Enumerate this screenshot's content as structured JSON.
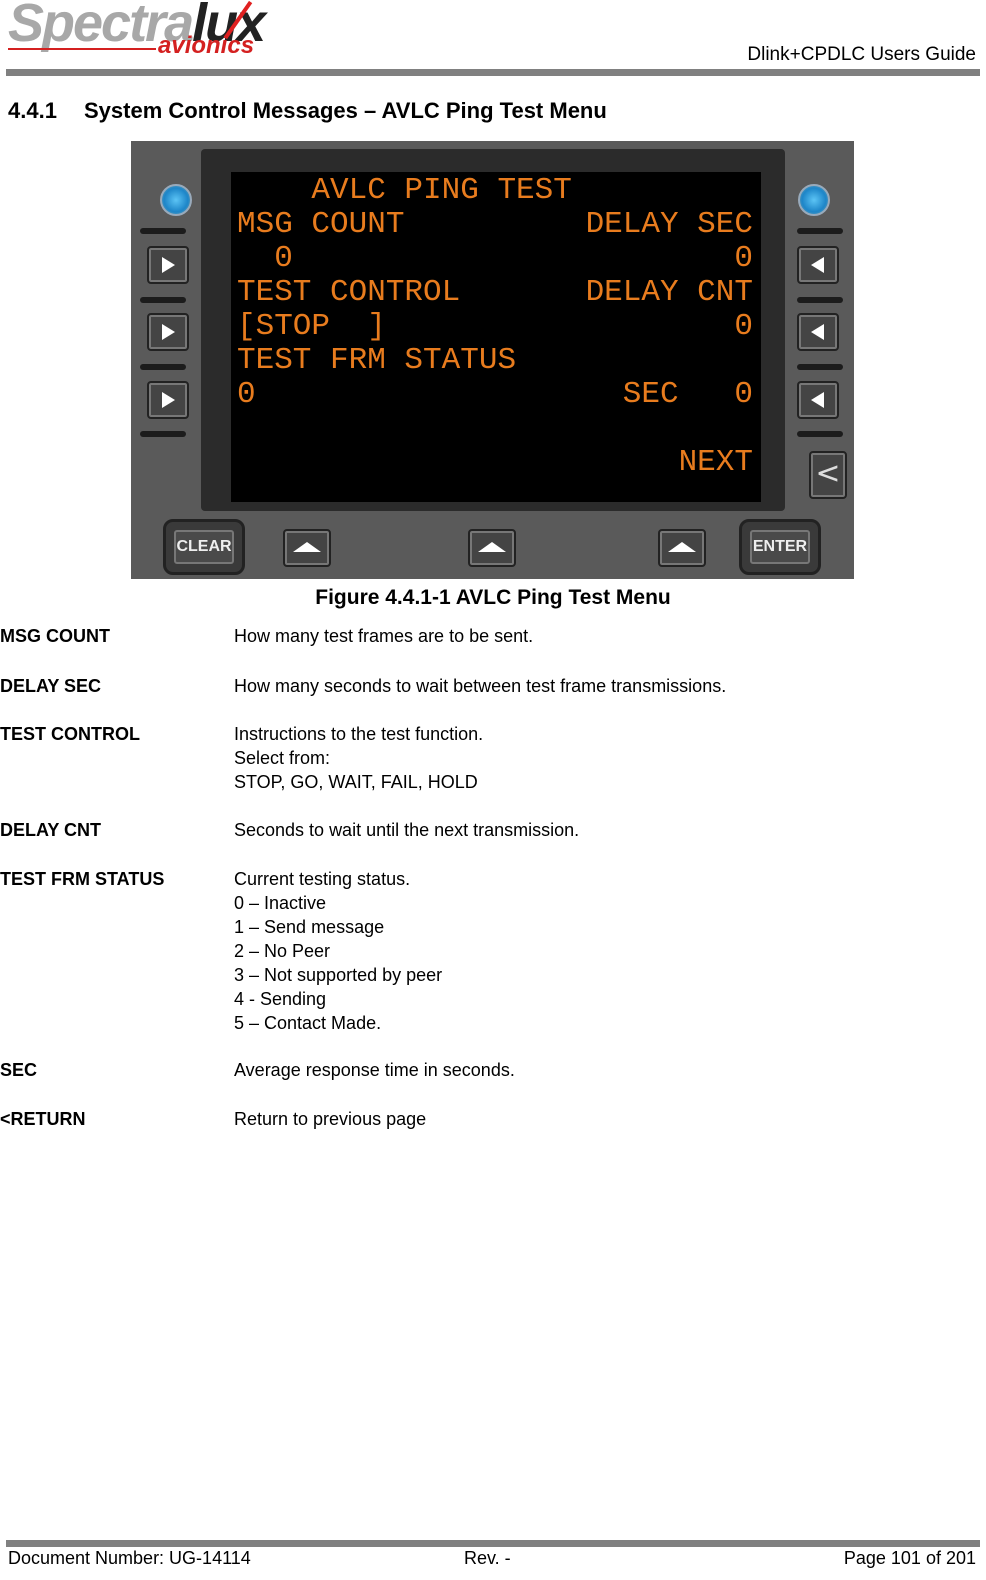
{
  "header": {
    "logo": {
      "brand_light": "Spectra",
      "brand_dark": "lux",
      "sub": "avionics"
    },
    "doc_title": "Dlink+CPDLC Users Guide"
  },
  "section": {
    "number": "4.4.1",
    "title": "System Control Messages – AVLC Ping Test Menu"
  },
  "figure": {
    "screen": {
      "lines": [
        {
          "left": "    AVLC PING TEST",
          "right": ""
        },
        {
          "left": "MSG COUNT",
          "right": "DELAY SEC"
        },
        {
          "left": "  0",
          "right": "0"
        },
        {
          "left": "TEST CONTROL",
          "right": "DELAY CNT"
        },
        {
          "left": "[STOP  ]",
          "right": "0"
        },
        {
          "left": "TEST FRM STATUS",
          "right": ""
        },
        {
          "left": "0",
          "right": "SEC   0"
        },
        {
          "left": "",
          "right": ""
        },
        {
          "left": "",
          "right": "NEXT"
        }
      ],
      "text_color": "#e87c1e"
    },
    "buttons": {
      "clear": "CLEAR",
      "enter": "ENTER",
      "return_glyph": "<"
    },
    "caption": "Figure 4.4.1-1 AVLC Ping Test Menu"
  },
  "definitions": [
    {
      "term": "MSG COUNT",
      "lines": [
        "How many test frames are to be sent."
      ]
    },
    {
      "term": "DELAY SEC",
      "lines": [
        "How many seconds to wait between test frame transmissions."
      ]
    },
    {
      "term": "TEST CONTROL",
      "lines": [
        "Instructions to the test function.",
        "Select from:",
        "STOP, GO, WAIT, FAIL, HOLD"
      ]
    },
    {
      "term": "DELAY CNT",
      "lines": [
        "Seconds to wait until the next transmission."
      ]
    },
    {
      "term": "TEST FRM STATUS",
      "lines": [
        "Current testing status.",
        "0 – Inactive",
        "1 – Send message",
        "2 – No Peer",
        "3 – Not supported by peer",
        "4 - Sending",
        "5 – Contact Made."
      ]
    },
    {
      "term": "SEC",
      "lines": [
        "Average response time in seconds."
      ]
    },
    {
      "term": "<RETURN",
      "lines": [
        "Return to previous page"
      ]
    }
  ],
  "footer": {
    "doc_number": "Document Number:  UG-14114",
    "rev": "Rev. -",
    "page": "Page 101 of 201"
  }
}
